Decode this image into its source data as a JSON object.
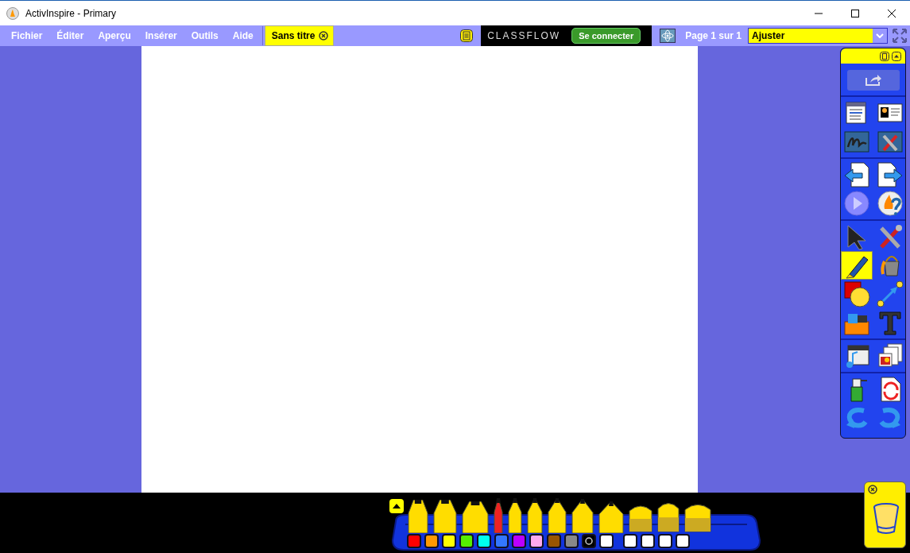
{
  "window": {
    "title": "ActivInspire - Primary"
  },
  "menu": [
    "Fichier",
    "Éditer",
    "Aperçu",
    "Insérer",
    "Outils",
    "Aide"
  ],
  "tabs": [
    {
      "label": "Sans titre",
      "selected": true
    }
  ],
  "classflow": {
    "logo": "CLASSFLOW",
    "button": "Se connecter"
  },
  "page_indicator": "Page 1 sur 1",
  "zoom": {
    "value": "Ajuster"
  },
  "toolbox": {
    "groups": [
      [
        {
          "selected": false
        },
        {
          "selected": false
        },
        {
          "selected": false
        },
        {
          "selected": false
        }
      ],
      [
        {
          "selected": false
        },
        {
          "selected": false
        },
        {
          "selected": false
        },
        {
          "selected": false
        }
      ],
      [
        {
          "selected": false
        },
        {
          "selected": false
        },
        {
          "selected": true
        },
        {
          "selected": false
        },
        {
          "selected": false
        },
        {
          "selected": false
        },
        {
          "selected": false
        },
        {
          "selected": false
        }
      ],
      [
        {
          "selected": false
        },
        {
          "selected": false
        }
      ],
      [
        {
          "selected": false
        },
        {
          "selected": false
        },
        {
          "selected": false
        },
        {
          "selected": false
        }
      ]
    ]
  },
  "swatches": [
    {
      "kind": "color",
      "color": "#ff0000"
    },
    {
      "kind": "color",
      "color": "#ff9900"
    },
    {
      "kind": "color",
      "color": "#ffff00"
    },
    {
      "kind": "color",
      "color": "#55ee00"
    },
    {
      "kind": "color",
      "color": "#00ffee"
    },
    {
      "kind": "color",
      "color": "#3377ff"
    },
    {
      "kind": "color",
      "color": "#bb00ff"
    },
    {
      "kind": "color",
      "color": "#ffaaee"
    },
    {
      "kind": "color",
      "color": "#995500"
    },
    {
      "kind": "color",
      "color": "#888888"
    },
    {
      "kind": "picker",
      "color": "#000000"
    },
    {
      "kind": "color",
      "color": "#ffffff"
    },
    {
      "kind": "color",
      "color": "#ffffff"
    },
    {
      "kind": "color",
      "color": "#ffffff"
    },
    {
      "kind": "color",
      "color": "#ffffff"
    },
    {
      "kind": "color",
      "color": "#ffffff"
    }
  ]
}
